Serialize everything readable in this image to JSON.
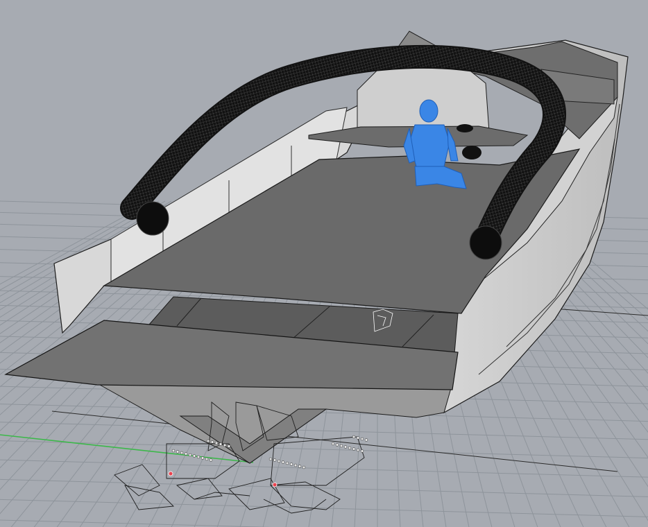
{
  "viewport": {
    "view": "perspective",
    "background_color": "#a7abb2",
    "grid_color": "#8e949b",
    "axis_x_color": "#3cb84a",
    "hull_color": "#cfcfcf",
    "deck_color": "#6a6a6a",
    "platform_color": "#7a7a7a",
    "tube_color": "#141414",
    "figure_color": "#3a86e6"
  },
  "scene": {
    "objects": [
      "hull",
      "wheelhouse-console",
      "bow-deck",
      "deck-plate",
      "transom-platform",
      "tow-arch",
      "seated-figure",
      "waterjet-drives"
    ]
  }
}
